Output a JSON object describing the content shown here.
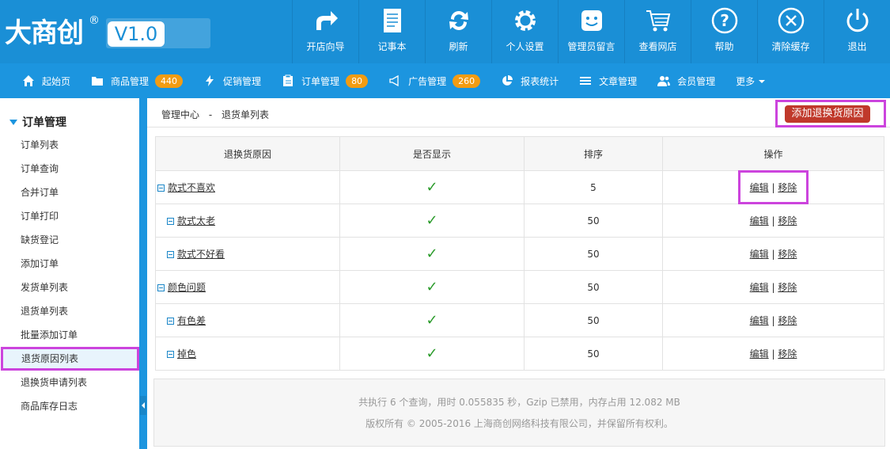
{
  "logo": {
    "text": "大商创",
    "reg": "®",
    "version": "V1.0"
  },
  "topnav": [
    {
      "label": "开店向导",
      "icon": "share-arrow-icon"
    },
    {
      "label": "记事本",
      "icon": "notepad-icon"
    },
    {
      "label": "刷新",
      "icon": "refresh-icon"
    },
    {
      "label": "个人设置",
      "icon": "gear-icon"
    },
    {
      "label": "管理员留言",
      "icon": "smiley-icon"
    },
    {
      "label": "查看网店",
      "icon": "cart-icon"
    },
    {
      "label": "帮助",
      "icon": "help-icon"
    },
    {
      "label": "清除缓存",
      "icon": "clear-icon"
    },
    {
      "label": "退出",
      "icon": "power-icon"
    }
  ],
  "subnav": [
    {
      "label": "起始页",
      "icon": "home-icon"
    },
    {
      "label": "商品管理",
      "icon": "folder-icon",
      "badge": "440"
    },
    {
      "label": "促销管理",
      "icon": "lightning-icon"
    },
    {
      "label": "订单管理",
      "icon": "clipboard-icon",
      "badge": "80"
    },
    {
      "label": "广告管理",
      "icon": "megaphone-icon",
      "badge": "260"
    },
    {
      "label": "报表统计",
      "icon": "piechart-icon"
    },
    {
      "label": "文章管理",
      "icon": "list-icon"
    },
    {
      "label": "会员管理",
      "icon": "users-icon"
    },
    {
      "label": "更多",
      "icon": ""
    }
  ],
  "sidebar": {
    "title": "订单管理",
    "items": [
      "订单列表",
      "订单查询",
      "合并订单",
      "订单打印",
      "缺货登记",
      "添加订单",
      "发货单列表",
      "退货单列表",
      "批量添加订单",
      "退货原因列表",
      "退换货申请列表",
      "商品库存日志"
    ],
    "active_index": 9
  },
  "breadcrumb": {
    "root": "管理中心",
    "sep": "-",
    "current": "退货单列表"
  },
  "add_button": "添加退换货原因",
  "table": {
    "headers": [
      "退换货原因",
      "是否显示",
      "排序",
      "操作"
    ],
    "rows": [
      {
        "name": "款式不喜欢",
        "level": 0,
        "shown": "✓",
        "sort": "5"
      },
      {
        "name": "款式太老",
        "level": 1,
        "shown": "✓",
        "sort": "50"
      },
      {
        "name": "款式不好看",
        "level": 1,
        "shown": "✓",
        "sort": "50"
      },
      {
        "name": "颜色问题",
        "level": 0,
        "shown": "✓",
        "sort": "50"
      },
      {
        "name": "有色差",
        "level": 1,
        "shown": "✓",
        "sort": "50"
      },
      {
        "name": "掉色",
        "level": 1,
        "shown": "✓",
        "sort": "50"
      }
    ],
    "edit_label": "编辑",
    "remove_label": "移除",
    "op_sep": "|"
  },
  "footer": {
    "line1": "共执行 6 个查询，用时 0.055835 秒，Gzip 已禁用，内存占用 12.082 MB",
    "line2": "版权所有 © 2005-2016 上海商创网络科技有限公司，并保留所有权利。"
  },
  "colors": {
    "header": "#1a8fd6",
    "subnav": "#1c95df",
    "badge": "#f39c12",
    "add_button": "#c0392b",
    "highlight": "#cc44dd",
    "check": "#2a9b2a"
  }
}
